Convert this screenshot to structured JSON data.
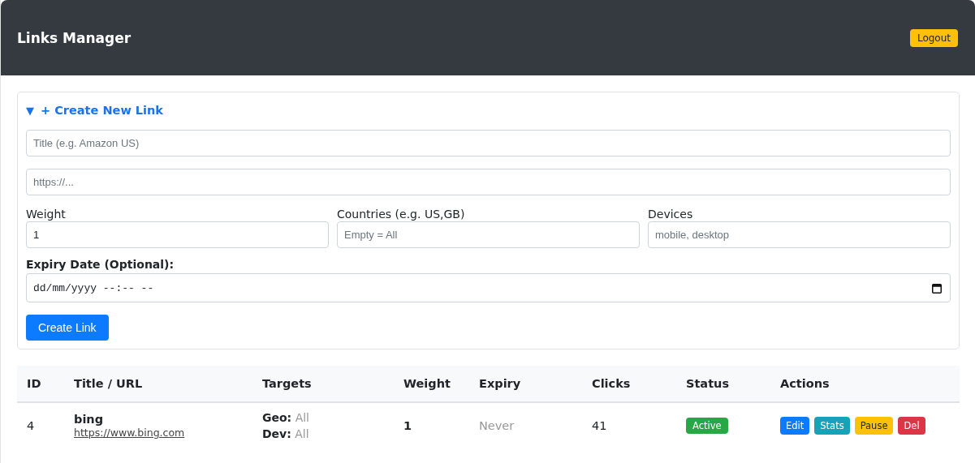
{
  "header": {
    "title": "Links Manager",
    "logout": "Logout"
  },
  "form": {
    "expanded": true,
    "toggle": "▼",
    "title": "+ Create New Link",
    "title_field": {
      "placeholder": "Title (e.g. Amazon US)"
    },
    "url_field": {
      "placeholder": "https://..."
    },
    "fields": [
      {
        "label": "Weight",
        "value": "1"
      },
      {
        "label": "Countries (e.g. US,GB)",
        "placeholder": "Empty = All"
      },
      {
        "label": "Devices",
        "placeholder": "mobile, desktop"
      }
    ],
    "expiry": {
      "label": "Expiry Date (Optional):",
      "value": "dd/mm/yyyy --:-- --"
    },
    "submit": "Create Link"
  },
  "table": {
    "columns": [
      "ID",
      "Title / URL",
      "Targets",
      "Weight",
      "Expiry",
      "Clicks",
      "Status",
      "Actions"
    ],
    "rows": [
      {
        "id": "4",
        "title": "bing",
        "url": "https://www.bing.com",
        "geo_label": "Geo:",
        "geo": "All",
        "dev_label": "Dev:",
        "dev": "All",
        "weight": "1",
        "expiry": "Never",
        "clicks": "41",
        "status": {
          "label": "Active",
          "active": true
        },
        "actions": [
          {
            "label": "Edit",
            "kind": "primary"
          },
          {
            "label": "Stats",
            "kind": "info"
          },
          {
            "label": "Pause",
            "kind": "warning"
          },
          {
            "label": "Del",
            "kind": "danger"
          }
        ]
      }
    ]
  }
}
